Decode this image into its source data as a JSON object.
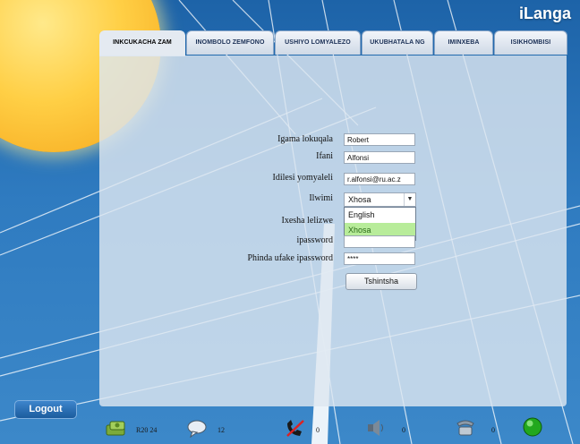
{
  "app": {
    "brand": "iLanga"
  },
  "tabs": [
    {
      "label": "INKCUKACHA ZAM",
      "active": true
    },
    {
      "label": "INOMBOLO ZEMFONO",
      "active": false
    },
    {
      "label": "USHIYO LOMYALEZO",
      "active": false
    },
    {
      "label": "UKUBHATALA NG",
      "active": false
    },
    {
      "label": "IMINXEBA",
      "active": false
    },
    {
      "label": "ISIKHOMBISI",
      "active": false
    }
  ],
  "form": {
    "first_name": {
      "label": "Igama lokuqala",
      "value": "Robert"
    },
    "surname": {
      "label": "Ifani",
      "value": "Alfonsi"
    },
    "email": {
      "label": "Idilesi yomyaleli",
      "value": "r.alfonsi@ru.ac.z"
    },
    "language": {
      "label": "Ilwimi",
      "value": "Xhosa",
      "options": [
        "English",
        "Xhosa"
      ],
      "highlighted": "Xhosa"
    },
    "timezone": {
      "label": "Ixesha lelizwe"
    },
    "password": {
      "label": "ipassword"
    },
    "confirm_password": {
      "label": "Phinda ufake ipassword",
      "value": "****"
    },
    "submit_label": "Tshintsha"
  },
  "logout_label": "Logout",
  "status_bar": {
    "balance": "R20 24",
    "messages": "12",
    "missed_calls": "0",
    "voicemail": "0",
    "transfers": "0"
  },
  "colors": {
    "accent": "#2f7bc0",
    "sun": "#ffcf45",
    "selected_option": "#b8ec9a",
    "status_online": "#22a81e"
  }
}
